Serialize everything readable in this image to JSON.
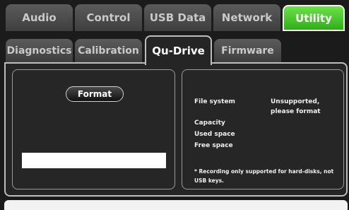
{
  "tabs_top": [
    "Audio",
    "Control",
    "USB Data",
    "Network",
    "Utility"
  ],
  "tabs_sub": [
    "Diagnostics",
    "Calibration",
    "Qu-Drive",
    "Firmware"
  ],
  "format_button": "Format",
  "info": {
    "file_system_label": "File system",
    "file_system_value_line1": "Unsupported,",
    "file_system_value_line2": "please format",
    "capacity_label": "Capacity",
    "used_label": "Used space",
    "free_label": "Free space",
    "note_line1": "* Recording only supported for hard-disks, not",
    "note_line2": "USB keys."
  },
  "colors": {
    "accent_green": "#3cc422",
    "background": "#1b1b1b"
  }
}
